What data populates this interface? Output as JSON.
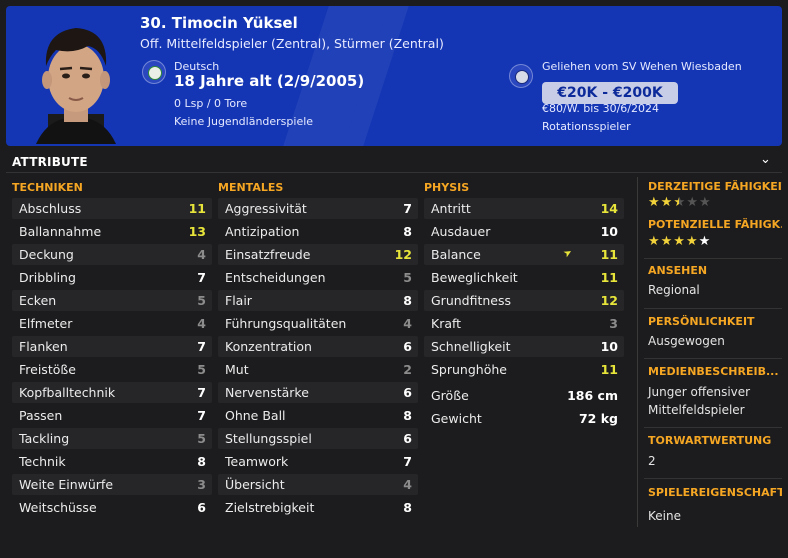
{
  "header": {
    "player_name": "30. Timocin Yüksel",
    "positions": "Off. Mittelfeldspieler (Zentral), Stürmer (Zentral)",
    "nationality": "Deutsch",
    "age": "18 Jahre alt (2/9/2005)",
    "appearances": "0 Lsp / 0 Tore",
    "youth_caps": "Keine Jugendländerspiele",
    "loan_from": "Geliehen vom SV Wehen Wiesbaden",
    "value_range": "€20K - €200K",
    "wage": "€80/W. bis 30/6/2024",
    "squad_status": "Rotationsspieler"
  },
  "section": {
    "title": "ATTRIBUTE"
  },
  "technical": {
    "title": "TECHNIKEN",
    "rows": [
      {
        "label": "Abschluss",
        "value": "11",
        "color": "y"
      },
      {
        "label": "Ballannahme",
        "value": "13",
        "color": "y"
      },
      {
        "label": "Deckung",
        "value": "4",
        "color": "g"
      },
      {
        "label": "Dribbling",
        "value": "7",
        "color": "w"
      },
      {
        "label": "Ecken",
        "value": "5",
        "color": "g"
      },
      {
        "label": "Elfmeter",
        "value": "4",
        "color": "g"
      },
      {
        "label": "Flanken",
        "value": "7",
        "color": "w"
      },
      {
        "label": "Freistöße",
        "value": "5",
        "color": "g"
      },
      {
        "label": "Kopfballtechnik",
        "value": "7",
        "color": "w"
      },
      {
        "label": "Passen",
        "value": "7",
        "color": "w"
      },
      {
        "label": "Tackling",
        "value": "5",
        "color": "g"
      },
      {
        "label": "Technik",
        "value": "8",
        "color": "w"
      },
      {
        "label": "Weite Einwürfe",
        "value": "3",
        "color": "g"
      },
      {
        "label": "Weitschüsse",
        "value": "6",
        "color": "w"
      }
    ]
  },
  "mental": {
    "title": "MENTALES",
    "rows": [
      {
        "label": "Aggressivität",
        "value": "7",
        "color": "w"
      },
      {
        "label": "Antizipation",
        "value": "8",
        "color": "w"
      },
      {
        "label": "Einsatzfreude",
        "value": "12",
        "color": "y"
      },
      {
        "label": "Entscheidungen",
        "value": "5",
        "color": "g"
      },
      {
        "label": "Flair",
        "value": "8",
        "color": "w"
      },
      {
        "label": "Führungsqualitäten",
        "value": "4",
        "color": "g"
      },
      {
        "label": "Konzentration",
        "value": "6",
        "color": "w"
      },
      {
        "label": "Mut",
        "value": "2",
        "color": "g"
      },
      {
        "label": "Nervenstärke",
        "value": "6",
        "color": "w"
      },
      {
        "label": "Ohne Ball",
        "value": "8",
        "color": "w"
      },
      {
        "label": "Stellungsspiel",
        "value": "6",
        "color": "w"
      },
      {
        "label": "Teamwork",
        "value": "7",
        "color": "w"
      },
      {
        "label": "Übersicht",
        "value": "4",
        "color": "g"
      },
      {
        "label": "Zielstrebigkeit",
        "value": "8",
        "color": "w"
      }
    ]
  },
  "physical": {
    "title": "PHYSIS",
    "rows": [
      {
        "label": "Antritt",
        "value": "14",
        "color": "y"
      },
      {
        "label": "Ausdauer",
        "value": "10",
        "color": "w"
      },
      {
        "label": "Balance",
        "value": "11",
        "color": "y"
      },
      {
        "label": "Beweglichkeit",
        "value": "11",
        "color": "y"
      },
      {
        "label": "Grundfitness",
        "value": "12",
        "color": "y"
      },
      {
        "label": "Kraft",
        "value": "3",
        "color": "g"
      },
      {
        "label": "Schnelligkeit",
        "value": "10",
        "color": "w"
      },
      {
        "label": "Sprunghöhe",
        "value": "11",
        "color": "y"
      }
    ],
    "height_label": "Größe",
    "height_value": "186 cm",
    "weight_label": "Gewicht",
    "weight_value": "72 kg"
  },
  "side": {
    "current_ability_title": "DERZEITIGE FÄHIGKEIT",
    "current_ability_stars": 2.5,
    "potential_ability_title": "POTENZIELLE FÄHIGK...",
    "potential_ability_stars": 4,
    "reputation_title": "ANSEHEN",
    "reputation_value": "Regional",
    "personality_title": "PERSÖNLICHKEIT",
    "personality_value": "Ausgewogen",
    "media_title": "MEDIENBESCHREIB...",
    "media_line1": "Junger offensiver",
    "media_line2": "Mittelfeldspieler",
    "gk_title": "TORWARTWERTUNG",
    "gk_value": "2",
    "traits_title": "SPIELEREIGENSCHAFT",
    "traits_value": "Keine"
  },
  "colors": {
    "header_bg": "#1436b4",
    "accent_orange": "#f5a623",
    "highlight_yellow": "#e8e53a"
  },
  "icons": {
    "nation": "dfb-badge-icon",
    "club": "club-badge-icon",
    "expand": "chevron-down-icon",
    "trend": "arrow-up-icon"
  }
}
